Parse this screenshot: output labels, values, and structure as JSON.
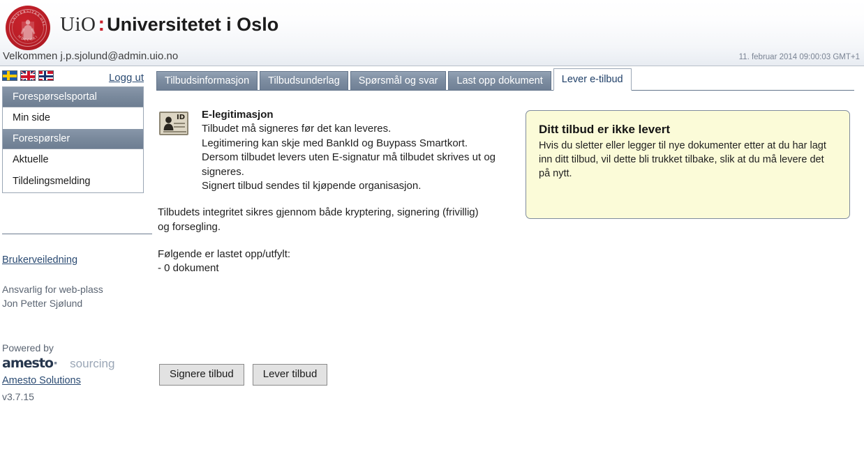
{
  "header": {
    "logo_seal_name": "uio-seal",
    "wordmark_abbrev": "UiO",
    "wordmark_separator": ":",
    "wordmark_full": "Universitetet i Oslo",
    "welcome": "Velkommen j.p.sjolund@admin.uio.no",
    "clock": "11. februar 2014 09:00:03 GMT+1",
    "accent_red": "#c8202a"
  },
  "sidebar": {
    "flags": [
      {
        "name": "flag-sweden",
        "label": "Svenska"
      },
      {
        "name": "flag-uk",
        "label": "English"
      },
      {
        "name": "flag-norway",
        "label": "Norsk"
      }
    ],
    "logout_label": "Logg ut",
    "groups": [
      {
        "header": "Forespørselsportal",
        "items": [
          "Min side"
        ]
      },
      {
        "header": "Forespørsler",
        "items": [
          "Aktuelle",
          "Tildelingsmelding"
        ]
      }
    ],
    "user_guide_link": "Brukerveiledning",
    "responsible_label": "Ansvarlig for web-plass",
    "responsible_name": "Jon Petter Sjølund",
    "powered_by_label": "Powered by",
    "vendor_logo_word": "amesto",
    "vendor_logo_dot": "·",
    "vendor_logo_suffix": "sourcing",
    "vendor_link": "Amesto Solutions",
    "version": "v3.7.15"
  },
  "main": {
    "tabs": [
      {
        "label": "Tilbudsinformasjon",
        "active": false
      },
      {
        "label": "Tilbudsunderlag",
        "active": false
      },
      {
        "label": "Spørsmål og svar",
        "active": false
      },
      {
        "label": "Last opp dokument",
        "active": false
      },
      {
        "label": "Lever e-tilbud",
        "active": true
      }
    ],
    "eid": {
      "icon_name": "id-card-icon",
      "icon_badge_text": "ID",
      "title": "E-legitimasjon",
      "lines": [
        "Tilbudet må signeres før det kan leveres.",
        "Legitimering kan skje med BankId og Buypass Smartkort.",
        "Dersom tilbudet levers uten E-signatur må tilbudet skrives ut og signeres.",
        "Signert tilbud sendes til kjøpende organisasjon."
      ]
    },
    "integrity_paragraph": "Tilbudets integritet sikres gjennom både kryptering, signering (frivillig) og forsegling.",
    "uploaded_heading": "Følgende er lastet opp/utfylt:",
    "uploaded_count_line": "- 0 dokument",
    "buttons": [
      {
        "label": "Signere tilbud",
        "name": "sign-offer-button"
      },
      {
        "label": "Lever tilbud",
        "name": "submit-offer-button"
      }
    ],
    "notice": {
      "title": "Ditt tilbud er ikke levert",
      "body": "Hvis du sletter eller legger til nye dokumenter etter at du har lagt inn ditt tilbud, vil dette bli trukket tilbake, slik at du må levere det på nytt.",
      "background": "#fbfbd8",
      "border": "#7f8b9c"
    }
  }
}
